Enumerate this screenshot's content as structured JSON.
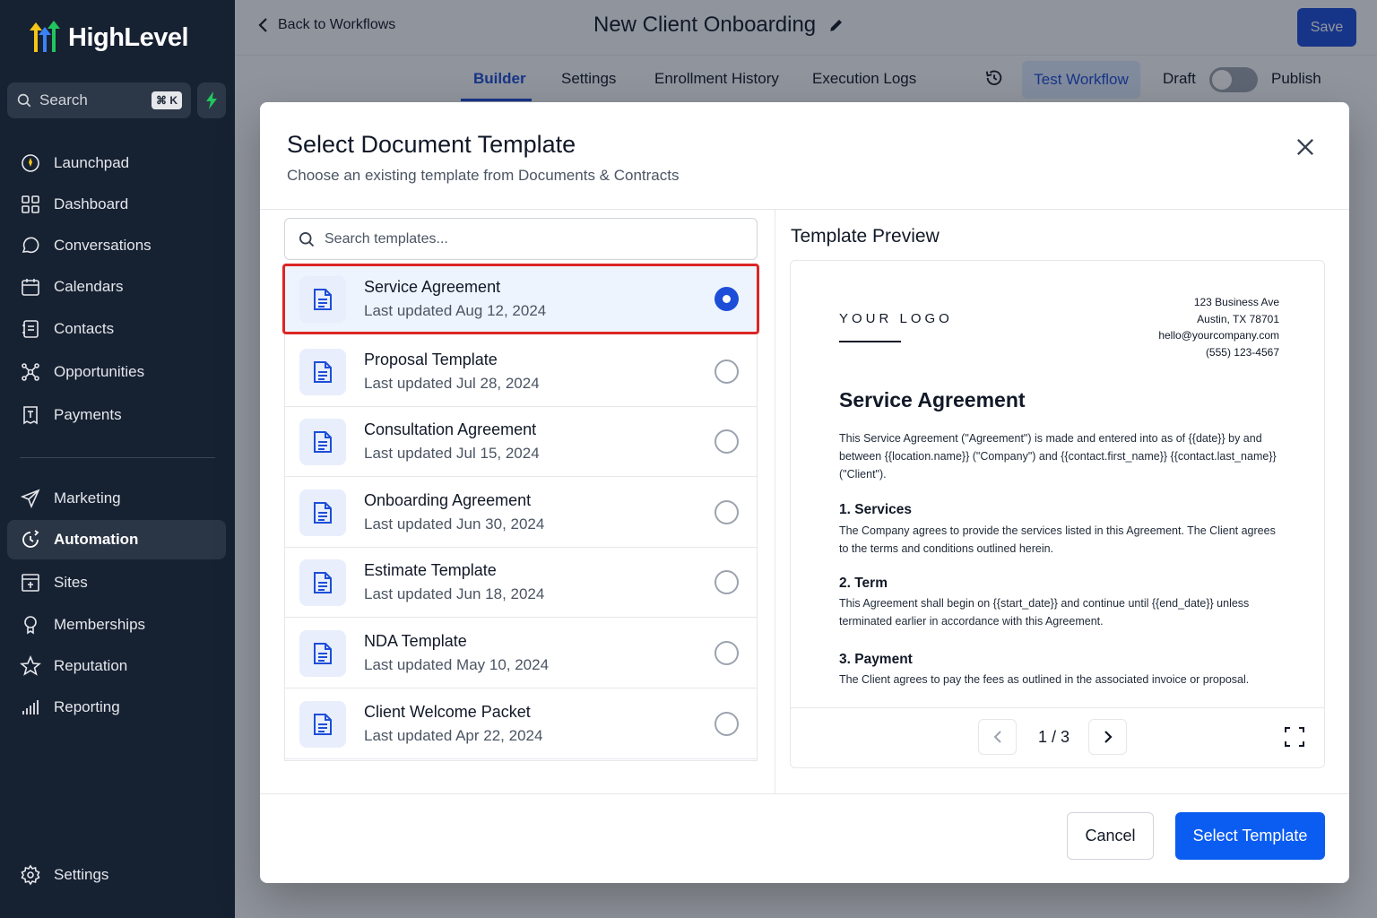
{
  "sidebar": {
    "brand": "HighLevel",
    "search_label": "Search",
    "search_shortcut": "⌘ K",
    "items": [
      {
        "label": "Launchpad",
        "icon": "launchpad-icon"
      },
      {
        "label": "Dashboard",
        "icon": "dashboard-icon"
      },
      {
        "label": "Conversations",
        "icon": "chat-bubble-icon"
      },
      {
        "label": "Calendars",
        "icon": "calendar-icon"
      },
      {
        "label": "Contacts",
        "icon": "contacts-icon"
      },
      {
        "label": "Opportunities",
        "icon": "opportunities-icon"
      },
      {
        "label": "Payments",
        "icon": "payments-icon"
      },
      {
        "label": "Marketing",
        "icon": "send-icon"
      },
      {
        "label": "Automation",
        "icon": "automation-icon",
        "active": true
      },
      {
        "label": "Sites",
        "icon": "sites-icon"
      },
      {
        "label": "Memberships",
        "icon": "memberships-icon"
      },
      {
        "label": "Reputation",
        "icon": "star-icon"
      },
      {
        "label": "Reporting",
        "icon": "bar-chart-icon"
      }
    ],
    "settings_label": "Settings"
  },
  "topbar": {
    "back_label": "Back to Workflows",
    "workflow_title": "New Client Onboarding",
    "save_label": "Save"
  },
  "tabs": {
    "items": [
      "Builder",
      "Settings",
      "Enrollment History",
      "Execution Logs"
    ],
    "active": "Builder",
    "test_workflow_label": "Test Workflow",
    "draft_label": "Draft",
    "publish_label": "Publish"
  },
  "modal": {
    "title": "Select Document Template",
    "subtitle": "Choose an existing template from Documents & Contracts",
    "search_placeholder": "Search templates...",
    "templates": [
      {
        "name": "Service Agreement",
        "date": "Last updated Aug 12, 2024",
        "selected": true
      },
      {
        "name": "Proposal Template",
        "date": "Last updated Jul 28, 2024",
        "selected": false
      },
      {
        "name": "Consultation Agreement",
        "date": "Last updated Jul 15, 2024",
        "selected": false
      },
      {
        "name": "Onboarding Agreement",
        "date": "Last updated Jun 30, 2024",
        "selected": false
      },
      {
        "name": "Estimate Template",
        "date": "Last updated Jun 18, 2024",
        "selected": false
      },
      {
        "name": "NDA Template",
        "date": "Last updated May 10, 2024",
        "selected": false
      },
      {
        "name": "Client Welcome Packet",
        "date": "Last updated Apr 22, 2024",
        "selected": false
      }
    ],
    "preview": {
      "heading": "Template Preview",
      "logo_text": "YOUR LOGO",
      "address_lines": [
        "123 Business Ave",
        "Austin, TX 78701",
        "hello@yourcompany.com",
        "(555) 123-4567"
      ],
      "doc_title": "Service Agreement",
      "intro": "This Service Agreement (\"Agreement\") is made and entered into as of {{date}} by and between {{location.name}} (\"Company\") and {{contact.first_name}} {{contact.last_name}} (\"Client\").",
      "sections": [
        {
          "heading": "1. Services",
          "body": "The Company agrees to provide the services listed in this Agreement. The Client agrees to the terms and conditions outlined herein."
        },
        {
          "heading": "2. Term",
          "body": "This Agreement shall begin on {{start_date}} and continue until {{end_date}} unless terminated earlier in accordance with this Agreement."
        },
        {
          "heading": "3. Payment",
          "body": "The Client agrees to pay the fees as outlined in the associated invoice or proposal."
        }
      ],
      "page_indicator": "1 / 3"
    },
    "cancel_label": "Cancel",
    "select_label": "Select Template"
  },
  "colors": {
    "primary": "#1d4ed8",
    "sidebar_bg": "#162132",
    "selection_outline": "#dc2626"
  }
}
